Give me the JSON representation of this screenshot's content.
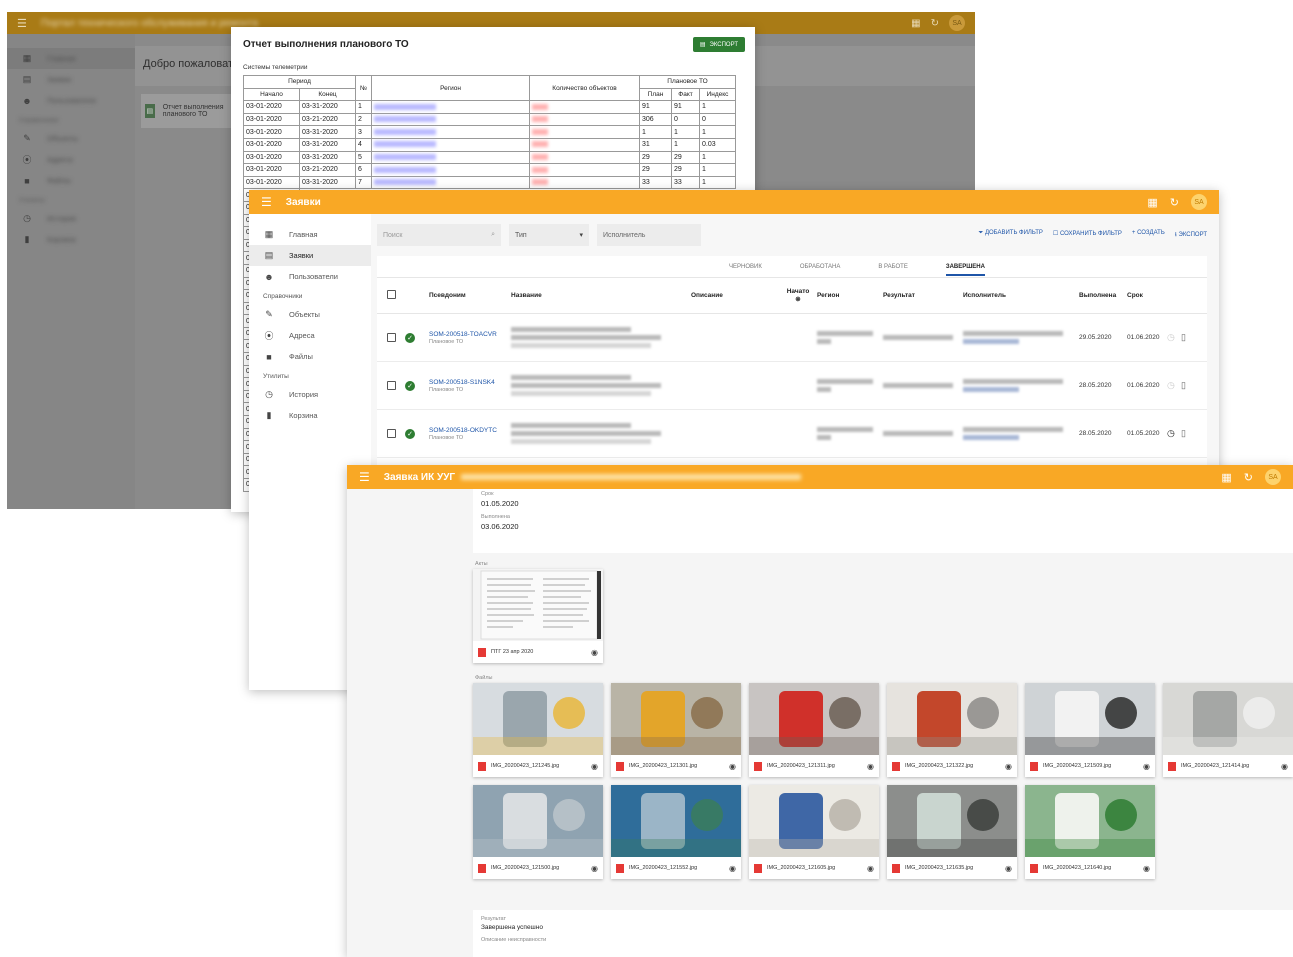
{
  "portal_window": {
    "app_title": "Портал технического обслуживания и ремонта",
    "avatar": "SA",
    "sidebar": [
      {
        "label": "Главная",
        "icon": "dashboard-icon",
        "active": true
      },
      {
        "label": "Заявки",
        "icon": "request-icon"
      },
      {
        "label": "Пользователи",
        "icon": "users-icon"
      }
    ],
    "sidebar_sec1": "Справочники",
    "sidebar_refs": [
      {
        "label": "Объекты",
        "icon": "wrench-icon"
      },
      {
        "label": "Адреса",
        "icon": "pin-icon"
      },
      {
        "label": "Файлы",
        "icon": "folder-icon"
      }
    ],
    "sidebar_sec2": "Утилиты",
    "sidebar_utils": [
      {
        "label": "История",
        "icon": "history-icon"
      },
      {
        "label": "Корзина",
        "icon": "trash-icon"
      }
    ],
    "welcome": "Добро пожаловать",
    "card_label": "Отчет выполнения планового ТО"
  },
  "report_dialog": {
    "title": "Отчет выполнения планового ТО",
    "export_label": "ЭКСПОРТ",
    "subtitle": "Системы телеметрии",
    "headers": {
      "period": "Период",
      "start": "Начало",
      "end": "Конец",
      "num": "№",
      "region": "Регион",
      "objects": "Количество объектов",
      "planned": "Плановое ТО",
      "plan": "План",
      "fact": "Факт",
      "index": "Индекс"
    },
    "rows": [
      {
        "start": "03-01-2020",
        "end": "03-31-2020",
        "num": "1",
        "plan": "91",
        "fact": "91",
        "index": "1"
      },
      {
        "start": "03-01-2020",
        "end": "03-21-2020",
        "num": "2",
        "plan": "306",
        "fact": "0",
        "index": "0"
      },
      {
        "start": "03-01-2020",
        "end": "03-31-2020",
        "num": "3",
        "plan": "1",
        "fact": "1",
        "index": "1"
      },
      {
        "start": "03-01-2020",
        "end": "03-31-2020",
        "num": "4",
        "plan": "31",
        "fact": "1",
        "index": "0.03"
      },
      {
        "start": "03-01-2020",
        "end": "03-31-2020",
        "num": "5",
        "plan": "29",
        "fact": "29",
        "index": "1"
      },
      {
        "start": "03-01-2020",
        "end": "03-21-2020",
        "num": "6",
        "plan": "29",
        "fact": "29",
        "index": "1"
      },
      {
        "start": "03-01-2020",
        "end": "03-31-2020",
        "num": "7",
        "plan": "33",
        "fact": "33",
        "index": "1"
      }
    ],
    "left_edge_stub": "03"
  },
  "requests_window": {
    "title": "Заявки",
    "avatar": "SA",
    "sidebar": [
      {
        "label": "Главная",
        "icon": "dashboard-icon"
      },
      {
        "label": "Заявки",
        "icon": "request-icon",
        "active": true
      },
      {
        "label": "Пользователи",
        "icon": "users-icon"
      }
    ],
    "sidebar_sec1": "Справочники",
    "sidebar_refs": [
      {
        "label": "Объекты",
        "icon": "wrench-icon"
      },
      {
        "label": "Адреса",
        "icon": "pin-icon"
      },
      {
        "label": "Файлы",
        "icon": "folder-icon"
      }
    ],
    "sidebar_sec2": "Утилиты",
    "sidebar_utils": [
      {
        "label": "История",
        "icon": "history-icon"
      },
      {
        "label": "Корзина",
        "icon": "trash-icon"
      }
    ],
    "search_placeholder": "Поиск",
    "type_label": "Тип",
    "executor_label": "Исполнитель",
    "actions": {
      "add_filter": "ДОБАВИТЬ ФИЛЬТР",
      "save_filter": "СОХРАНИТЬ ФИЛЬТР",
      "create": "СОЗДАТЬ",
      "export": "ЭКСПОРТ"
    },
    "tabs": [
      "ЧЕРНОВИК",
      "ОБРАБОТАНА",
      "В РАБОТЕ",
      "ЗАВЕРШЕНА"
    ],
    "active_tab": "ЗАВЕРШЕНА",
    "columns": {
      "alias": "Псевдоним",
      "name": "Название",
      "description": "Описание",
      "started": "Начато",
      "region": "Регион",
      "result": "Результат",
      "executor": "Исполнитель",
      "done": "Выполнена",
      "due": "Срок"
    },
    "rows": [
      {
        "alias": "SOM-200518-TOACVR",
        "kind": "Плановое ТО",
        "done": "29.05.2020",
        "due": "01.06.2020"
      },
      {
        "alias": "SOM-200518-S1NSK4",
        "kind": "Плановое ТО",
        "done": "28.05.2020",
        "due": "01.06.2020"
      },
      {
        "alias": "SOM-200518-OKDYTC",
        "kind": "Плановое ТО",
        "done": "28.05.2020",
        "due": "01.05.2020"
      }
    ]
  },
  "detail_window": {
    "title": "Заявка ИК УУГ",
    "avatar": "SA",
    "field_date_label": "Срок",
    "field_date": "01.05.2020",
    "field_done_label": "Выполнена",
    "field_done": "03.06.2020",
    "acts_label": "Акты",
    "act_file": "ПТГ 23 апр 2020",
    "files_label": "Файлы",
    "files": [
      "IMG_20200423_121245.jpg",
      "IMG_20200423_121301.jpg",
      "IMG_20200423_121311.jpg",
      "IMG_20200423_121322.jpg",
      "IMG_20200423_121509.jpg",
      "IMG_20200423_121414.jpg",
      "IMG_20200423_121500.jpg",
      "IMG_20200423_121552.jpg",
      "IMG_20200423_121605.jpg",
      "IMG_20200423_121635.jpg",
      "IMG_20200423_121640.jpg"
    ],
    "result_label": "Результат",
    "result_value": "Завершена успешно",
    "fault_label": "Описание неисправности"
  },
  "colors": {
    "accent": "#f9a825",
    "link": "#1e55a8",
    "success": "#2e7d32",
    "pdf": "#e53935"
  }
}
